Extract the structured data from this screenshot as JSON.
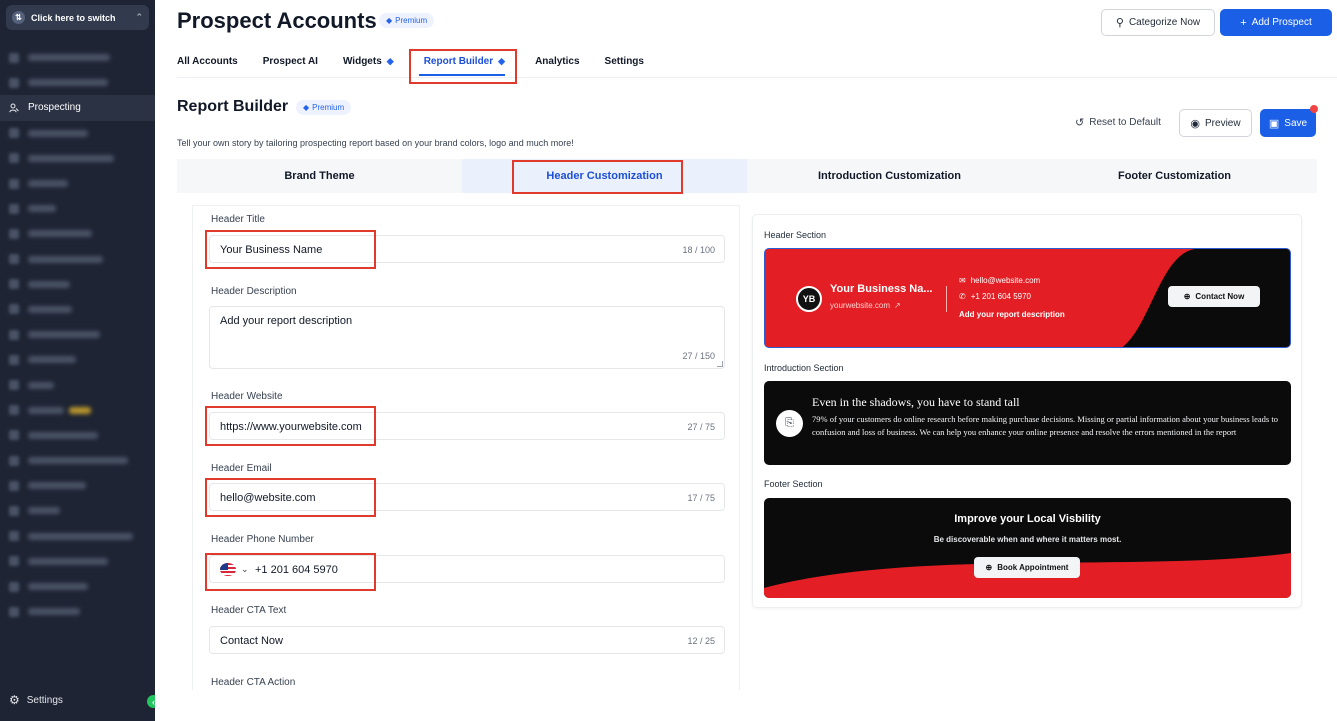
{
  "sidebar": {
    "switcher_label": "Click here to switch",
    "active_item": "Prospecting",
    "settings_label": "Settings",
    "collapse_icon": "chevron-left-icon"
  },
  "header": {
    "title": "Prospect Accounts",
    "badge": "Premium",
    "categorize_label": "Categorize Now",
    "add_label": "Add Prospect"
  },
  "tabs": [
    {
      "label": "All Accounts"
    },
    {
      "label": "Prospect AI"
    },
    {
      "label": "Widgets"
    },
    {
      "label": "Report Builder"
    },
    {
      "label": "Analytics"
    },
    {
      "label": "Settings"
    }
  ],
  "report": {
    "title": "Report Builder",
    "badge": "Premium",
    "subtitle": "Tell your own story by tailoring prospecting report based on your brand colors, logo and much more!",
    "reset_label": "Reset to Default",
    "preview_label": "Preview",
    "save_label": "Save"
  },
  "subtabs": [
    {
      "label": "Brand Theme"
    },
    {
      "label": "Header Customization"
    },
    {
      "label": "Introduction Customization"
    },
    {
      "label": "Footer Customization"
    }
  ],
  "form": {
    "title_label": "Header Title",
    "title_value": "Your Business Name",
    "title_count": "18 / 100",
    "desc_label": "Header Description",
    "desc_value": "Add your report description",
    "desc_count": "27 / 150",
    "website_label": "Header Website",
    "website_value": "https://www.yourwebsite.com",
    "website_count": "27 / 75",
    "email_label": "Header Email",
    "email_value": "hello@website.com",
    "email_count": "17 / 75",
    "phone_label": "Header Phone Number",
    "phone_value": "+1 201 604 5970",
    "cta_label": "Header CTA Text",
    "cta_value": "Contact Now",
    "cta_count": "12 / 25",
    "cta_action_label": "Header CTA Action"
  },
  "preview": {
    "header_section_label": "Header Section",
    "initials": "YB",
    "business_name": "Your Business Na...",
    "website": "yourwebsite.com",
    "email": "hello@website.com",
    "phone": "+1 201 604 5970",
    "description": "Add your report description",
    "cta": "Contact Now",
    "intro_section_label": "Introduction Section",
    "intro_title": "Even in the shadows, you have to stand tall",
    "intro_text": "79% of your customers do online research before making purchase decisions. Missing or partial information about your business leads to confusion and loss of business. We can help you enhance your online presence and resolve the errors mentioned in the report",
    "footer_section_label": "Footer Section",
    "footer_title": "Improve your Local Visbility",
    "footer_sub": "Be discoverable when and where it matters most.",
    "footer_cta": "Book Appointment"
  },
  "colors": {
    "accent": "#1a5fe6",
    "brand_red": "#e31e24",
    "highlight": "#e03a2c",
    "sidebar_bg": "#1e2433"
  }
}
